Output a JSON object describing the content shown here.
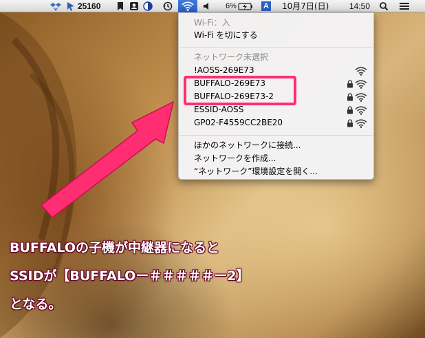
{
  "menubar": {
    "counter": "25160",
    "battery": "6%",
    "input_method": "A",
    "date": "10月7日(日)",
    "time": "14:50"
  },
  "wifi_menu": {
    "status": "Wi-Fi：入",
    "toggle": "Wi-Fi を切にする",
    "section_header": "ネットワーク未選択",
    "networks": [
      {
        "name": "!AOSS-269E73",
        "locked": false
      },
      {
        "name": "BUFFALO-269E73",
        "locked": true
      },
      {
        "name": "BUFFALO-269E73-2",
        "locked": true
      },
      {
        "name": "ESSID-AOSS",
        "locked": true
      },
      {
        "name": "GP02-F4559CC2BE20",
        "locked": true
      }
    ],
    "join_other": "ほかのネットワークに接続...",
    "create": "ネットワークを作成...",
    "open_prefs": "“ネットワーク”環境設定を開く..."
  },
  "caption": {
    "line1": "BUFFALOの子機が中継器になると",
    "line2": "SSIDが【BUFFALOー＃＃＃＃＃ー2】",
    "line3": "となる。"
  },
  "colors": {
    "highlight": "#ff2d72",
    "menubar_active": "#2a5fc4"
  }
}
